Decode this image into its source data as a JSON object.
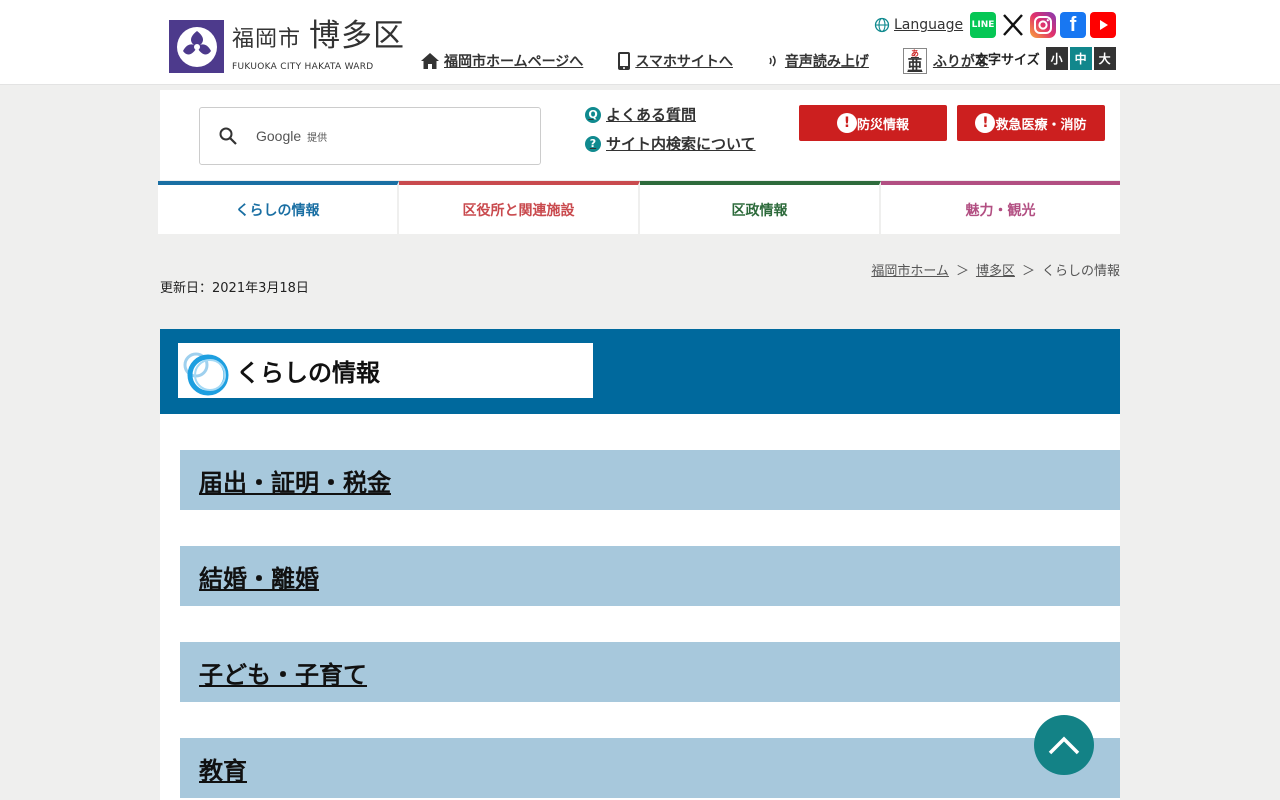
{
  "header": {
    "logo": {
      "jp_city": "福岡市",
      "jp_ward": "博多区",
      "en": "FUKUOKA CITY HAKATA WARD"
    },
    "language_label": "Language",
    "util_links": [
      {
        "label": "福岡市ホームページへ",
        "icon": "home-icon"
      },
      {
        "label": "スマホサイトへ",
        "icon": "smartphone-icon"
      },
      {
        "label": "音声読み上げ",
        "icon": "speaker-icon"
      },
      {
        "label": "ふりがな",
        "icon": "furigana-icon"
      }
    ],
    "furigana_icon": {
      "ruby": "あ",
      "kanji": "亜"
    },
    "sns": [
      {
        "name": "line-icon",
        "glyph": "LINE"
      },
      {
        "name": "x-icon",
        "glyph": "𝕏"
      },
      {
        "name": "instagram-icon",
        "glyph": ""
      },
      {
        "name": "facebook-icon",
        "glyph": "f"
      },
      {
        "name": "youtube-icon",
        "glyph": ""
      }
    ],
    "font_size": {
      "label": "文字サイズ",
      "options": [
        "小",
        "中",
        "大"
      ],
      "selected": "中"
    }
  },
  "search": {
    "provider": "Google",
    "provider_suffix": "提供"
  },
  "faq_links": [
    {
      "icon_glyph": "Q",
      "label": "よくある質問"
    },
    {
      "icon_glyph": "?",
      "label": "サイト内検索について"
    }
  ],
  "emergency": [
    {
      "label": "防災情報"
    },
    {
      "label": "救急医療・消防"
    }
  ],
  "gnav": [
    {
      "label": "くらしの情報",
      "color": "#1a6fa3"
    },
    {
      "label": "区役所と関連施設",
      "color": "#c94a4e"
    },
    {
      "label": "区政情報",
      "color": "#2e6b3c"
    },
    {
      "label": "魅力・観光",
      "color": "#b24f82"
    }
  ],
  "breadcrumb": [
    {
      "label": "福岡市ホーム"
    },
    {
      "label": "博多区"
    },
    {
      "label": "くらしの情報"
    }
  ],
  "breadcrumb_sep": "＞",
  "updated": "更新日：2021年3月18日",
  "page_title": "くらしの情報",
  "categories": [
    {
      "label": "届出・証明・税金"
    },
    {
      "label": "結婚・離婚"
    },
    {
      "label": "子ども・子育て"
    },
    {
      "label": "教育"
    }
  ],
  "colors": {
    "accent": "#00699d",
    "category_bg": "#a7c8dc",
    "emergency": "#cc1f1f",
    "teal": "#11878c"
  }
}
